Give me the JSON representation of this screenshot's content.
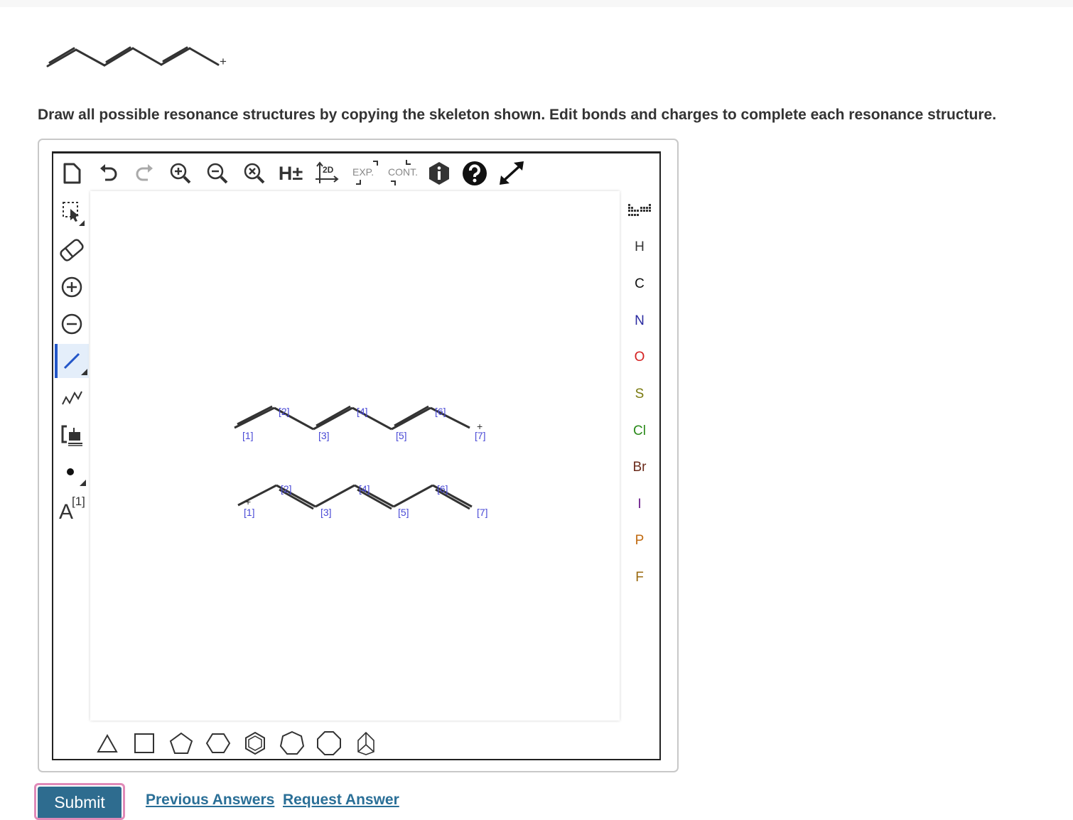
{
  "question": {
    "skeleton_charge": "+",
    "prompt": "Draw all possible resonance structures by copying the skeleton shown. Edit bonds and charges to complete each resonance structure."
  },
  "toolbar_top": {
    "h_toggle": "H±",
    "clean2d": "2D",
    "expand": "EXP.",
    "contract": "CONT."
  },
  "toolbar_left": {
    "atom_label_A": "A",
    "atom_label_map": "[1]"
  },
  "atoms": [
    "H",
    "C",
    "N",
    "O",
    "S",
    "Cl",
    "Br",
    "I",
    "P",
    "F"
  ],
  "atom_colors": {
    "H": "#333333",
    "C": "#111111",
    "N": "#2a2aa0",
    "O": "#d42020",
    "S": "#7a7a10",
    "Cl": "#2a8a1a",
    "Br": "#6a2a1a",
    "I": "#6a1a8a",
    "P": "#c06a10",
    "F": "#9a6a10"
  },
  "canvas": {
    "structure_1": {
      "labels": [
        "[1]",
        "[2]",
        "[3]",
        "[4]",
        "[5]",
        "[6]",
        "[7]"
      ],
      "charge": "+"
    },
    "structure_2": {
      "labels": [
        "[1]",
        "[2]",
        "[3]",
        "[4]",
        "[5]",
        "[6]",
        "[7]"
      ],
      "charge": "+"
    }
  },
  "actions": {
    "submit": "Submit",
    "previous_answers": "Previous Answers",
    "request_answer": "Request Answer"
  }
}
